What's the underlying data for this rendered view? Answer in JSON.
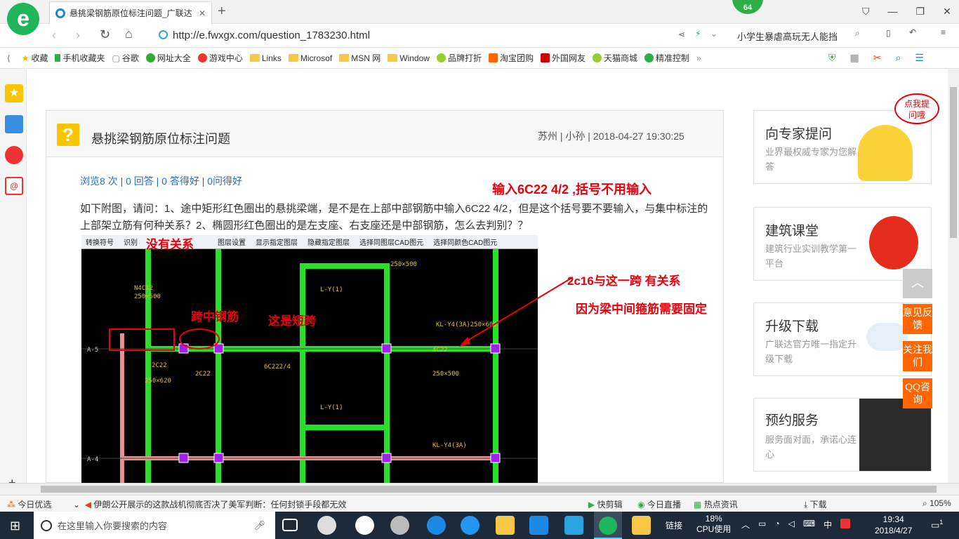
{
  "browser": {
    "tab_title": "悬挑梁钢筋原位标注问题_广联达",
    "url": "http://e.fwxgx.com/question_1783230.html",
    "search_text": "小学生暴虐高玩无人能挡",
    "badge": "64"
  },
  "bookmarks": [
    "收藏",
    "手机收藏夹",
    "谷歌",
    "网址大全",
    "游戏中心",
    "Links",
    "Microsof",
    "MSN 网",
    "Window",
    "品牌打折",
    "淘宝团购",
    "外国网友",
    "天猫商城",
    "精准控制"
  ],
  "question": {
    "title": "悬挑梁钢筋原位标注问题",
    "meta": "苏州 | 小孙 | 2018-04-27 19:30:25",
    "stats": "浏览8 次 | 0 回答 | 0 答得好 | 0问得好",
    "body": "如下附图，请问：1、途中矩形红色圈出的悬挑梁端，是不是在上部中部钢筋中输入6C22 4/2，但是这个括号要不要输入，与集中标注的上部架立筋有何种关系？2、椭圆形红色圈出的是左支座、右支座还是中部钢筋，怎么去判别？？"
  },
  "annotations": {
    "a1": "输入6C22 4/2 ,括号不用输入",
    "a2": "没有关系",
    "a3": "跨中钢筋",
    "a4": "这是短跨",
    "a5": "2c16与这一跨 有关系",
    "a6": "因为梁中间箍筋需要固定"
  },
  "cad_toolbar": [
    "转换符号",
    "识别",
    "图层设置",
    "显示指定图层",
    "隐藏指定图层",
    "选择同图层CAD图元",
    "选择同颜色CAD图元"
  ],
  "sidebar": [
    {
      "title": "向专家提问",
      "desc": "业界最权威专家为您解答"
    },
    {
      "title": "建筑课堂",
      "desc": "建筑行业实训教学第一平台"
    },
    {
      "title": "升级下载",
      "desc": "广联达官方唯一指定升级下载"
    },
    {
      "title": "预约服务",
      "desc": "服务面对面，承诺心连心"
    }
  ],
  "bubble": "点我提问哦",
  "float_buttons": [
    "意见反馈",
    "关注我们",
    "QQ咨询"
  ],
  "status": {
    "left": "今日优选",
    "news": "伊朗公开展示的这款战机彻底否决了美军判断：任何封锁手段都无效",
    "items": [
      "快剪辑",
      "今日直播",
      "热点资讯",
      "下载"
    ],
    "zoom": "105%"
  },
  "taskbar": {
    "search_placeholder": "在这里输入你要搜索的内容",
    "link": "链接",
    "cpu": "18%",
    "cpu_label": "CPU使用",
    "ime": "中",
    "time": "19:34",
    "date": "2018/4/27",
    "notif": "1"
  }
}
